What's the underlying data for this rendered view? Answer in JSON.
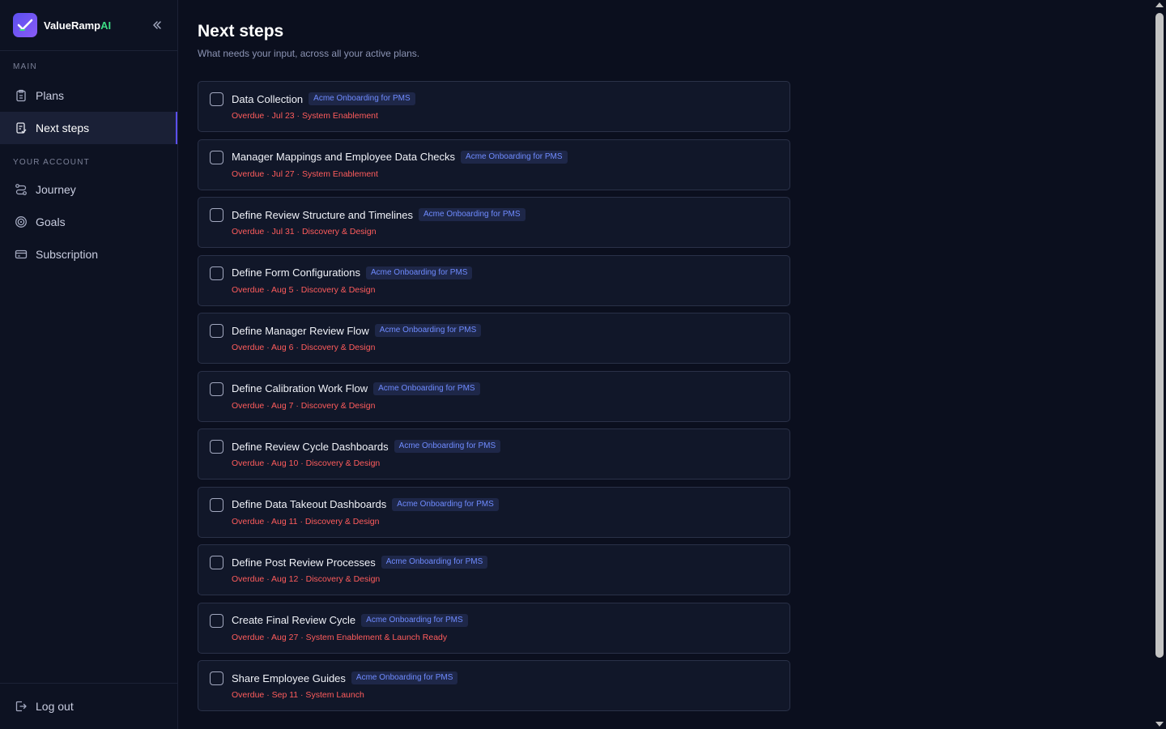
{
  "brand": {
    "name": "ValueRamp",
    "name_suffix": "AI"
  },
  "sidebar": {
    "sections": [
      {
        "label": "MAIN"
      },
      {
        "label": "YOUR ACCOUNT"
      }
    ],
    "items": [
      {
        "label": "Plans",
        "icon": "clipboard-icon"
      },
      {
        "label": "Next steps",
        "icon": "checklist-icon",
        "active": true
      },
      {
        "label": "Journey",
        "icon": "route-icon"
      },
      {
        "label": "Goals",
        "icon": "target-icon"
      },
      {
        "label": "Subscription",
        "icon": "card-icon"
      }
    ],
    "footer": {
      "label": "Log out",
      "icon": "logout-icon"
    }
  },
  "page": {
    "title": "Next steps",
    "subtitle": "What needs your input, across all your active plans."
  },
  "tasks": [
    {
      "title": "Data Collection",
      "plan": "Acme Onboarding for PMS",
      "meta": "Overdue · Jul 23 · System Enablement"
    },
    {
      "title": "Manager Mappings and Employee Data Checks",
      "plan": "Acme Onboarding for PMS",
      "meta": "Overdue · Jul 27 · System Enablement"
    },
    {
      "title": "Define Review Structure and Timelines",
      "plan": "Acme Onboarding for PMS",
      "meta": "Overdue · Jul 31 · Discovery & Design"
    },
    {
      "title": "Define Form Configurations",
      "plan": "Acme Onboarding for PMS",
      "meta": "Overdue · Aug 5 · Discovery & Design"
    },
    {
      "title": "Define Manager Review Flow",
      "plan": "Acme Onboarding for PMS",
      "meta": "Overdue · Aug 6 · Discovery & Design"
    },
    {
      "title": "Define Calibration Work Flow",
      "plan": "Acme Onboarding for PMS",
      "meta": "Overdue · Aug 7 · Discovery & Design"
    },
    {
      "title": "Define Review Cycle Dashboards",
      "plan": "Acme Onboarding for PMS",
      "meta": "Overdue · Aug 10 · Discovery & Design"
    },
    {
      "title": "Define Data Takeout Dashboards",
      "plan": "Acme Onboarding for PMS",
      "meta": "Overdue · Aug 11 · Discovery & Design"
    },
    {
      "title": "Define Post Review Processes",
      "plan": "Acme Onboarding for PMS",
      "meta": "Overdue · Aug 12 · Discovery & Design"
    },
    {
      "title": "Create Final Review Cycle",
      "plan": "Acme Onboarding for PMS",
      "meta": "Overdue · Aug 27 · System Enablement & Launch Ready"
    },
    {
      "title": "Share Employee Guides",
      "plan": "Acme Onboarding for PMS",
      "meta": "Overdue · Sep 11 · System Launch"
    }
  ],
  "colors": {
    "accent": "#5b4ff0",
    "overdue": "#ff5c5c",
    "badge_text": "#6f8bff",
    "brand_ai": "#3ddc84"
  }
}
